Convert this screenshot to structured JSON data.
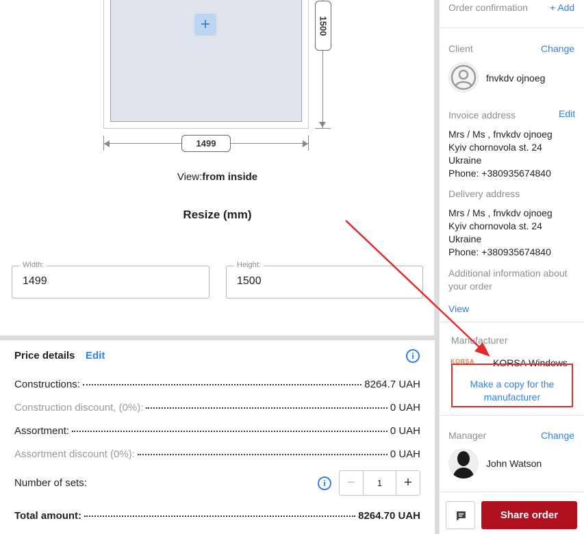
{
  "preview": {
    "height_dim": "1500",
    "width_dim": "1499",
    "view_label": "View:",
    "view_value": "from inside",
    "resize_title": "Resize (mm)",
    "width_label": "Width:",
    "width_value": "1499",
    "height_label": "Height:",
    "height_value": "1500",
    "add_icon": "plus-icon"
  },
  "price": {
    "title": "Price details",
    "edit_label": "Edit",
    "rows": [
      {
        "label": "Constructions:",
        "value": "8264.7 UAH"
      },
      {
        "label": "Construction discount, (0%):",
        "value": "0 UAH"
      },
      {
        "label": "Assortment:",
        "value": "0 UAH"
      },
      {
        "label": "Assortment discount (0%):",
        "value": "0 UAH"
      }
    ],
    "sets_label": "Number of sets:",
    "sets_value": "1",
    "total_label": "Total amount:",
    "total_value": "8264.70 UAH"
  },
  "sidebar": {
    "order_confirmation": "Order confirmation",
    "add_label": "+ Add",
    "client_label": "Client",
    "client_change": "Change",
    "client_name": "fnvkdv ojnoeg",
    "invoice_label": "Invoice address",
    "invoice_edit": "Edit",
    "invoice_lines": [
      "Mrs / Ms , fnvkdv ojnoeg",
      "Kyiv chornovola st. 24",
      "Ukraine",
      "Phone: +380935674840"
    ],
    "delivery_label": "Delivery address",
    "delivery_lines": [
      "Mrs / Ms , fnvkdv ojnoeg",
      "Kyiv chornovola st. 24",
      "Ukraine",
      "Phone: +380935674840"
    ],
    "additional_info": [
      "Additional information about",
      "your order"
    ],
    "view_link": "View",
    "manufacturer_label": "Manufacturer",
    "manufacturer_logo": "KORSA",
    "manufacturer_name": "KORSA Windows",
    "copy_line1": "Make a copy for the",
    "copy_line2": "manufacturer",
    "manager_label": "Manager",
    "manager_change": "Change",
    "manager_name": "John Watson",
    "share_label": "Share order",
    "chat_icon": "chat-icon"
  },
  "colors": {
    "accent": "#2f80ed",
    "primary_button": "#b1101f",
    "annotation": "#e22a2a"
  }
}
